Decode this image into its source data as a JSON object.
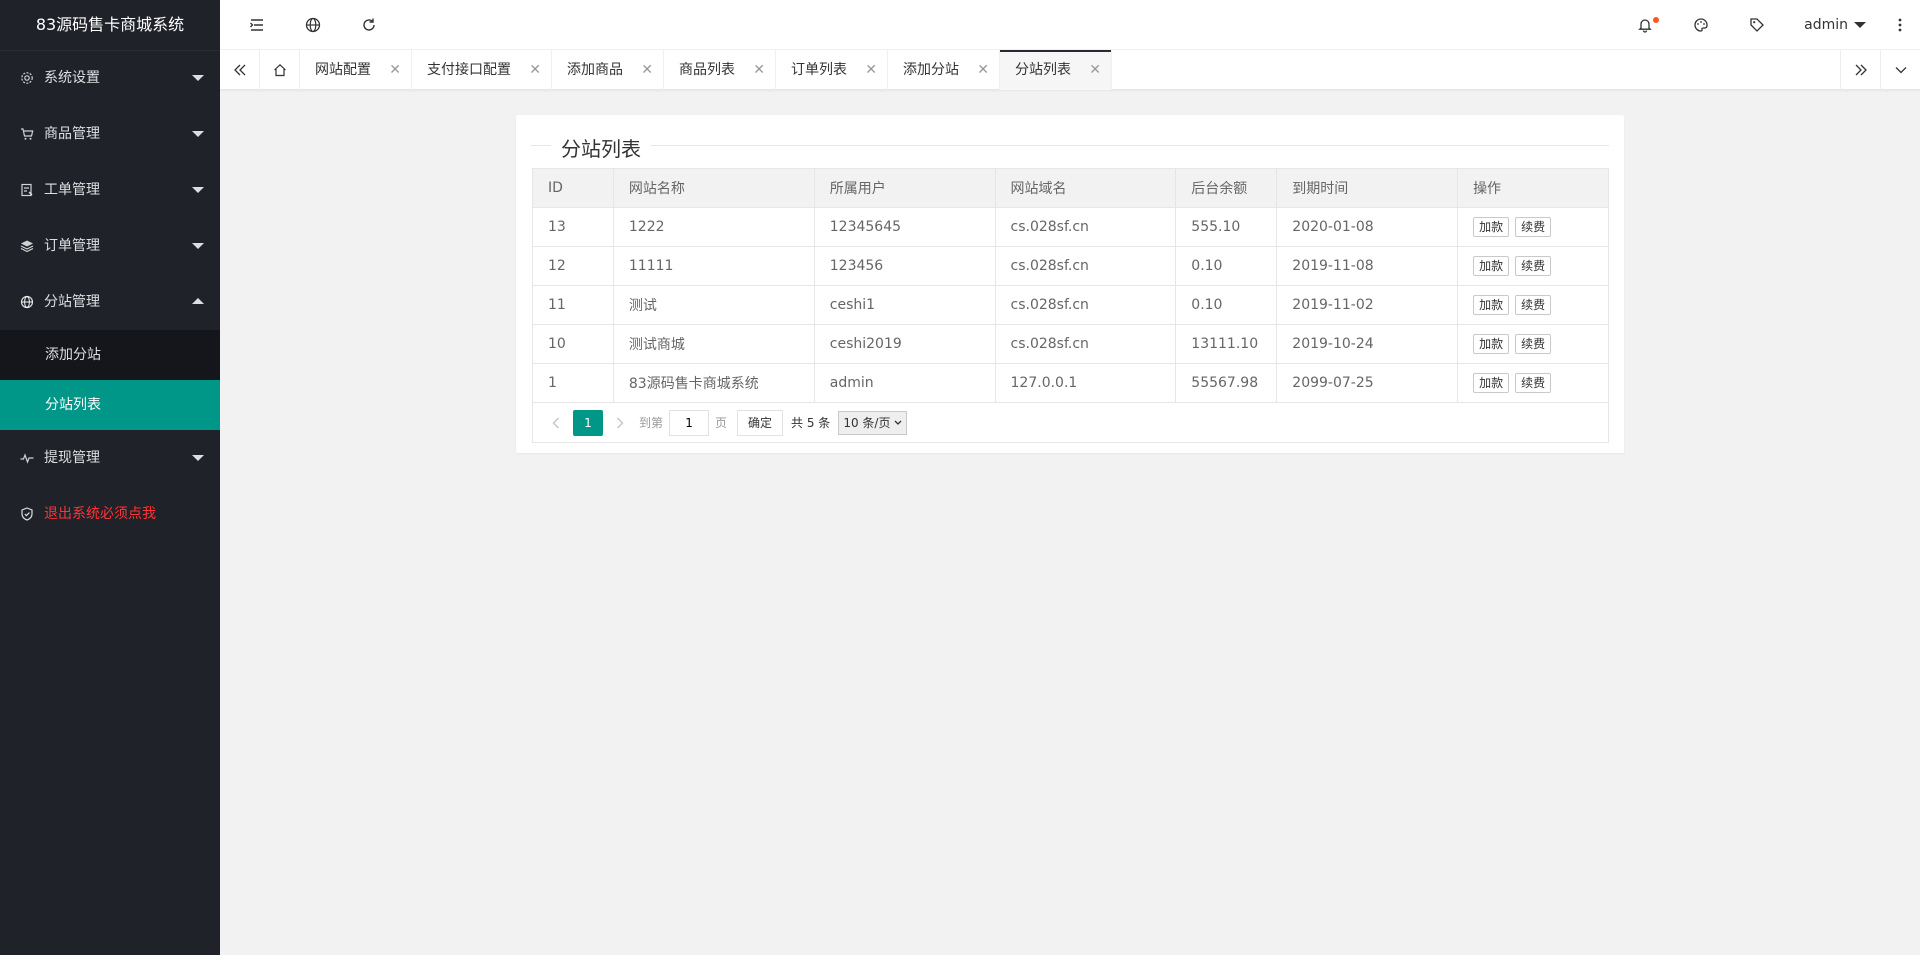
{
  "app": {
    "title": "83源码售卡商城系统"
  },
  "sidebar": {
    "items": [
      {
        "label": "系统设置",
        "icon": "gear-icon"
      },
      {
        "label": "商品管理",
        "icon": "cart-icon"
      },
      {
        "label": "工单管理",
        "icon": "ticket-icon"
      },
      {
        "label": "订单管理",
        "icon": "layers-icon"
      },
      {
        "label": "分站管理",
        "icon": "globe-icon",
        "expanded": true
      },
      {
        "label": "提现管理",
        "icon": "pulse-icon"
      }
    ],
    "sub_items": [
      {
        "label": "添加分站"
      },
      {
        "label": "分站列表",
        "active": true
      }
    ],
    "logout": "退出系统必须点我"
  },
  "header": {
    "user": "admin",
    "icons": [
      "menu-fold-icon",
      "globe-icon",
      "refresh-icon",
      "bell-icon",
      "theme-icon",
      "tag-icon",
      "more-icon"
    ]
  },
  "tabs": [
    {
      "label": "网站配置"
    },
    {
      "label": "支付接口配置"
    },
    {
      "label": "添加商品"
    },
    {
      "label": "商品列表"
    },
    {
      "label": "订单列表"
    },
    {
      "label": "添加分站"
    },
    {
      "label": "分站列表",
      "active": true
    }
  ],
  "main": {
    "title": "分站列表",
    "columns": [
      "ID",
      "网站名称",
      "所属用户",
      "网站域名",
      "后台余额",
      "到期时间",
      "操作"
    ],
    "rows": [
      {
        "id": "13",
        "name": "1222",
        "user": "12345645",
        "domain": "cs.028sf.cn",
        "balance": "555.10",
        "expire": "2020-01-08"
      },
      {
        "id": "12",
        "name": "11111",
        "user": "123456",
        "domain": "cs.028sf.cn",
        "balance": "0.10",
        "expire": "2019-11-08"
      },
      {
        "id": "11",
        "name": "测试",
        "user": "ceshi1",
        "domain": "cs.028sf.cn",
        "balance": "0.10",
        "expire": "2019-11-02"
      },
      {
        "id": "10",
        "name": "测试商城",
        "user": "ceshi2019",
        "domain": "cs.028sf.cn",
        "balance": "13111.10",
        "expire": "2019-10-24"
      },
      {
        "id": "1",
        "name": "83源码售卡商城系统",
        "user": "admin",
        "domain": "127.0.0.1",
        "balance": "55567.98",
        "expire": "2099-07-25"
      }
    ],
    "actions": {
      "recharge": "加款",
      "renew": "续费"
    }
  },
  "pager": {
    "current": "1",
    "goto_label": "到第",
    "goto_value": "1",
    "page_label": "页",
    "confirm": "确定",
    "total": "共 5 条",
    "per_page": "10 条/页"
  },
  "colors": {
    "accent": "#009688",
    "sidebar": "#20222a",
    "link": "#01aaed",
    "money": "#ff0000",
    "logout": "#ff3333"
  }
}
